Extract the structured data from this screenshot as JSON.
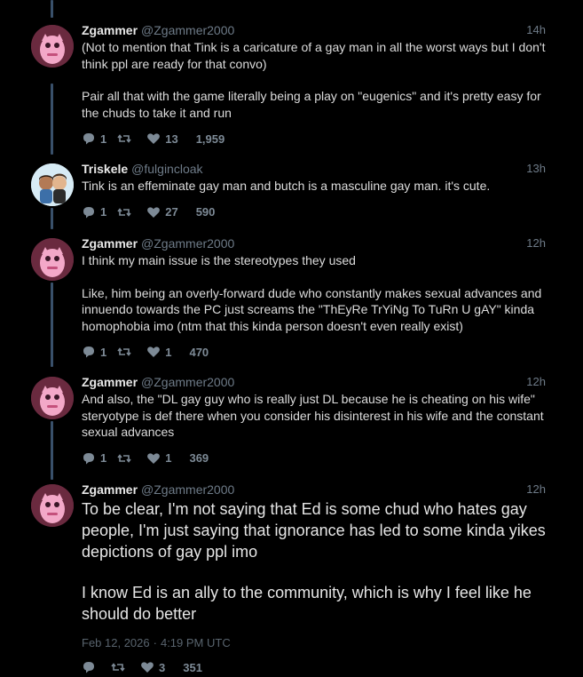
{
  "tweets": [
    {
      "name": "Zgammer",
      "handle": "@Zgammer2000",
      "time": "14h",
      "paragraphs": [
        "(Not to mention that Tink is a caricature of a gay man in all the worst ways but I don't think ppl are ready for that convo)",
        "Pair all that with the game literally being a play on \"eugenics\" and it's pretty easy for the chuds to take it and run"
      ],
      "replies": "1",
      "retweets": "",
      "likes": "13",
      "views": "1,959",
      "avatar_icon": "pink-monster-avatar"
    },
    {
      "name": "Triskele",
      "handle": "@fulgincloak",
      "time": "13h",
      "paragraphs": [
        "Tink is an effeminate gay man and butch is a masculine gay man. it's cute."
      ],
      "replies": "1",
      "retweets": "",
      "likes": "27",
      "views": "590",
      "avatar_icon": "two-characters-avatar"
    },
    {
      "name": "Zgammer",
      "handle": "@Zgammer2000",
      "time": "12h",
      "paragraphs": [
        "I think my main issue is the stereotypes they used",
        "Like, him being an overly-forward dude who constantly makes sexual advances and innuendo towards the PC just screams the \"ThEyRe TrYiNg To TuRn U gAY\" kinda homophobia imo (ntm that this kinda person doesn't even really exist)"
      ],
      "replies": "1",
      "retweets": "",
      "likes": "1",
      "views": "470",
      "avatar_icon": "pink-monster-avatar"
    },
    {
      "name": "Zgammer",
      "handle": "@Zgammer2000",
      "time": "12h",
      "paragraphs": [
        "And also, the \"DL gay guy who is really just DL because he is cheating on his wife\" steryotype is def there when you consider his disinterest in his wife and the constant sexual advances"
      ],
      "replies": "1",
      "retweets": "",
      "likes": "1",
      "views": "369",
      "avatar_icon": "pink-monster-avatar"
    },
    {
      "name": "Zgammer",
      "handle": "@Zgammer2000",
      "time": "12h",
      "paragraphs": [
        "To be clear, I'm not saying that Ed is some chud who hates gay people, I'm just saying that ignorance has led to some kinda yikes depictions of gay ppl imo",
        "I know Ed is an ally to the community, which is why I feel like he should do better"
      ],
      "date": "Feb 12, 2026",
      "date_sep": "·",
      "clock": "4:19 PM UTC",
      "replies": "",
      "retweets": "",
      "likes": "3",
      "views": "351",
      "avatar_icon": "pink-monster-avatar"
    }
  ],
  "colors": {
    "background": "#000000",
    "thread_line": "#39506a",
    "muted": "#6e7b88"
  }
}
